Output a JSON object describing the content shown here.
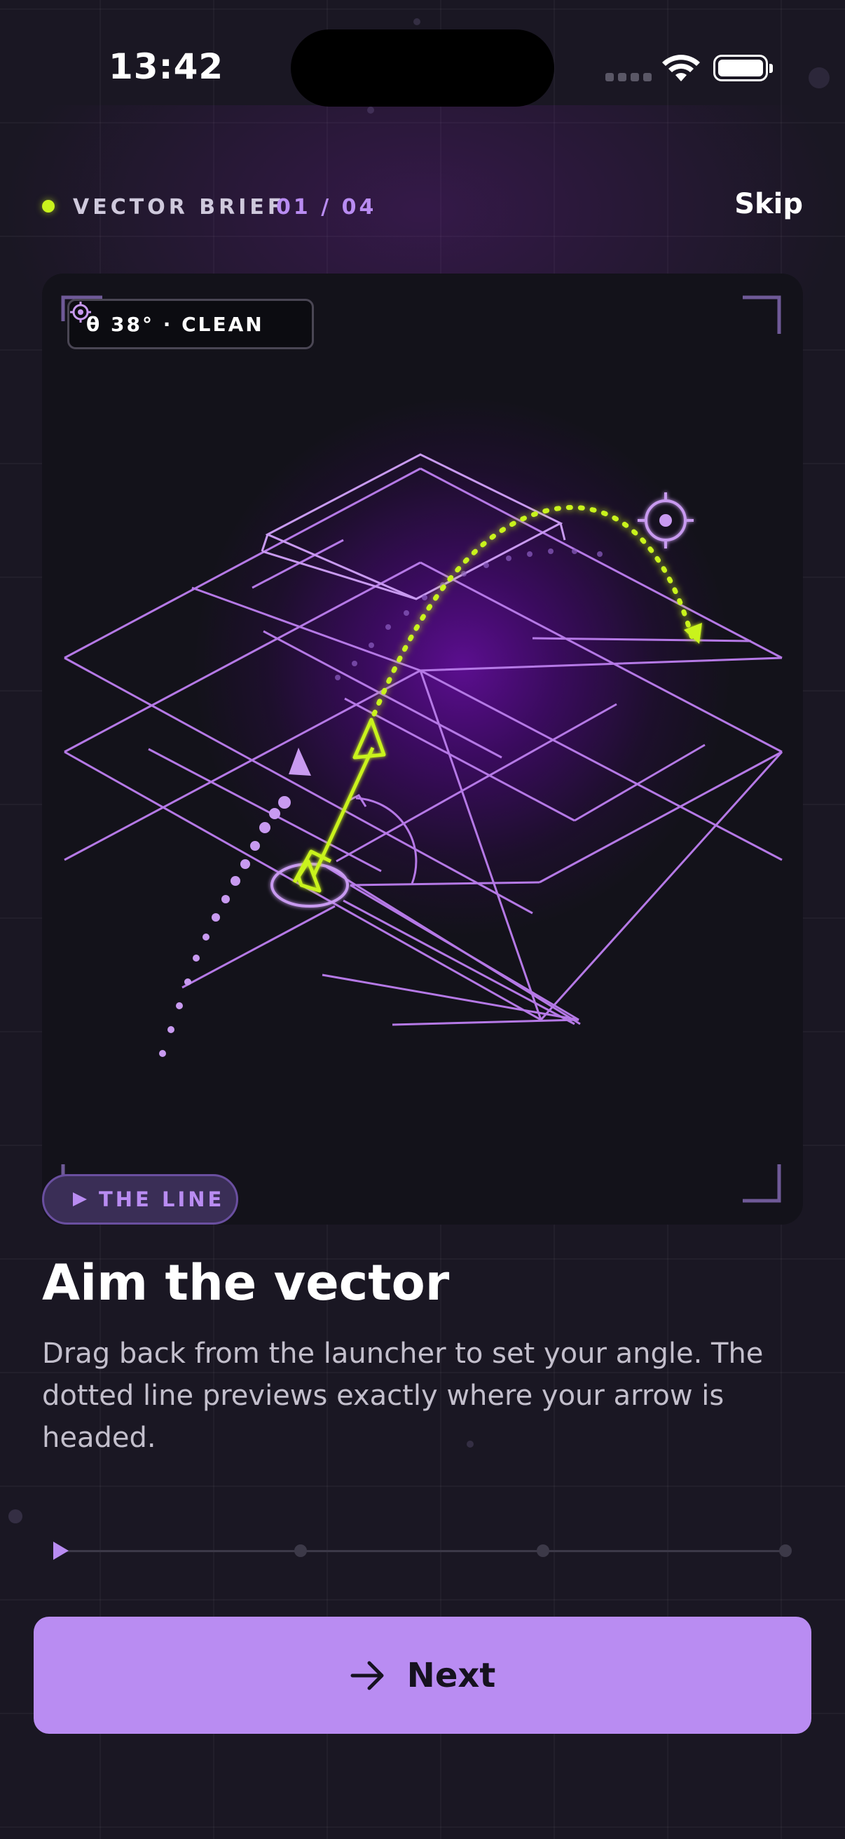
{
  "status_bar": {
    "time": "13:42"
  },
  "header": {
    "label": "VECTOR BRIEF",
    "step": "01 / 04",
    "skip_label": "Skip"
  },
  "illustration": {
    "readout": "θ 38° · CLEAN"
  },
  "step_chip": {
    "label": "THE LINE"
  },
  "content": {
    "title": "Aim the vector",
    "body": "Drag back from the launcher to set your angle. The dotted line previews exactly where your arrow is headed."
  },
  "progress": {
    "current_step": 1,
    "total_steps": 4
  },
  "cta": {
    "next_label": "Next"
  },
  "colors": {
    "accent": "#b98cf2",
    "highlight": "#c9f31d",
    "background": "#1a1723",
    "grid_lines": "#b579e6"
  },
  "icons": [
    "target-icon",
    "play-icon",
    "arrow-right-icon",
    "wifi-icon",
    "battery-icon"
  ]
}
